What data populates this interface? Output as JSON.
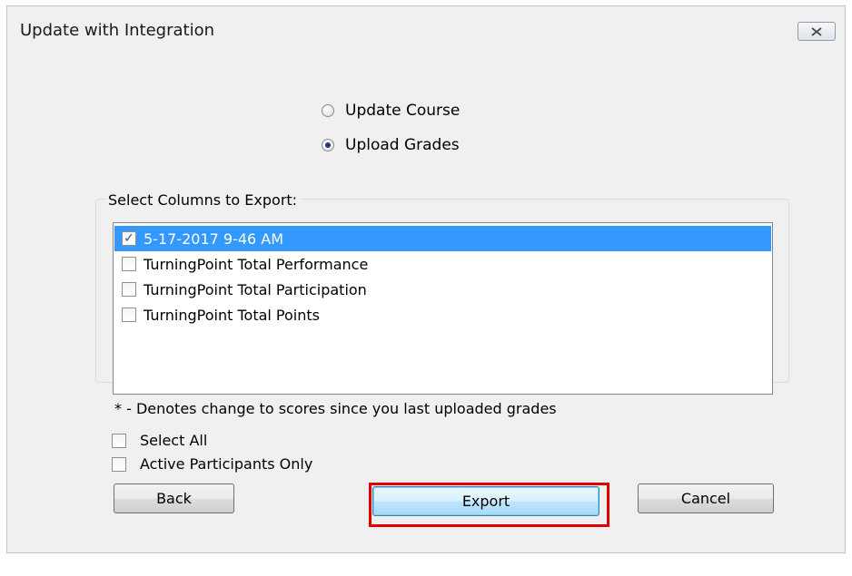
{
  "window": {
    "title": "Update with Integration"
  },
  "modes": [
    {
      "label": "Update Course",
      "checked": false
    },
    {
      "label": "Upload Grades",
      "checked": true
    }
  ],
  "columns_group": {
    "label": "Select Columns to Export:",
    "items": [
      {
        "label": "5-17-2017 9-46 AM",
        "checked": true,
        "selected": true
      },
      {
        "label": "TurningPoint Total Performance",
        "checked": false,
        "selected": false
      },
      {
        "label": "TurningPoint Total Participation",
        "checked": false,
        "selected": false
      },
      {
        "label": "TurningPoint Total Points",
        "checked": false,
        "selected": false
      }
    ]
  },
  "note": "* - Denotes change to scores since you last uploaded grades",
  "options": {
    "select_all": "Select All",
    "active_only": "Active Participants Only"
  },
  "buttons": {
    "back": "Back",
    "export": "Export",
    "cancel": "Cancel"
  },
  "colors": {
    "selection": "#3399ff",
    "highlight": "#e00000"
  }
}
